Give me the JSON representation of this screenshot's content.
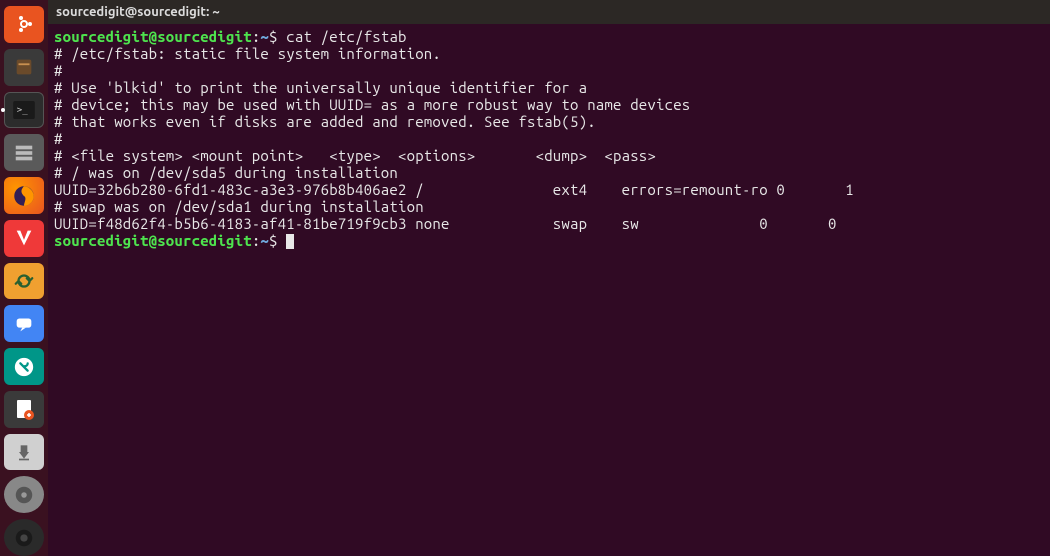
{
  "titlebar": {
    "text": "sourcedigit@sourcedigit: ~"
  },
  "prompt": {
    "user": "sourcedigit@sourcedigit",
    "sep": ":",
    "path": "~",
    "sigil": "$"
  },
  "cmd1": "cat /etc/fstab",
  "out": {
    "l1": "# /etc/fstab: static file system information.",
    "l2": "#",
    "l3": "# Use 'blkid' to print the universally unique identifier for a",
    "l4": "# device; this may be used with UUID= as a more robust way to name devices",
    "l5": "# that works even if disks are added and removed. See fstab(5).",
    "l6": "#",
    "l7": "# <file system> <mount point>   <type>  <options>       <dump>  <pass>",
    "l8": "# / was on /dev/sda5 during installation",
    "l9": "UUID=32b6b280-6fd1-483c-a3e3-976b8b406ae2 /               ext4    errors=remount-ro 0       1",
    "l10": "# swap was on /dev/sda1 during installation",
    "l11": "UUID=f48d62f4-b5b6-4183-af41-81be719f9cb3 none            swap    sw              0       0"
  },
  "dock": {
    "items": [
      {
        "name": "ubuntu-dash",
        "cls": "ubuntu-logo"
      },
      {
        "name": "files",
        "cls": "folder-icon"
      },
      {
        "name": "terminal",
        "cls": "terminal-icon",
        "active": true
      },
      {
        "name": "settings",
        "cls": "settings-bg"
      },
      {
        "name": "firefox",
        "cls": "firefox-icon"
      },
      {
        "name": "vivaldi",
        "cls": "vivaldi-icon"
      },
      {
        "name": "sync",
        "cls": "sync-icon"
      },
      {
        "name": "chat",
        "cls": "chat-icon"
      },
      {
        "name": "system-settings",
        "cls": "gear-icon"
      },
      {
        "name": "editor",
        "cls": "edit-icon"
      },
      {
        "name": "downloads",
        "cls": "download-icon"
      },
      {
        "name": "disks",
        "cls": "disk-icon"
      },
      {
        "name": "app",
        "cls": "dark-icon"
      }
    ]
  }
}
